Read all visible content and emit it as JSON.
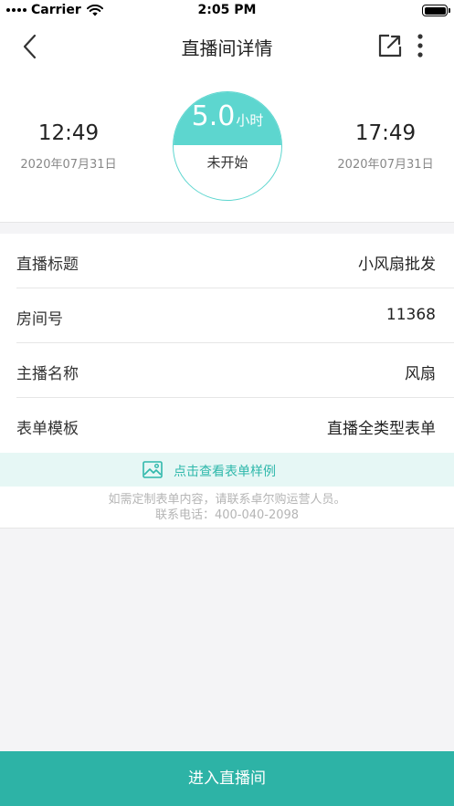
{
  "status_bar": {
    "carrier": "Carrier",
    "time": "2:05 PM"
  },
  "nav": {
    "title": "直播间详情",
    "back_icon": "chevron-left-icon",
    "share_icon": "share-icon",
    "more_icon": "more-vertical-icon"
  },
  "schedule": {
    "start_time": "12:49",
    "start_date": "2020年07月31日",
    "duration_value": "5.0",
    "duration_unit": "小时",
    "status": "未开始",
    "end_time": "17:49",
    "end_date": "2020年07月31日"
  },
  "details": {
    "title_label": "直播标题",
    "title_value": "小风扇批发",
    "room_label": "房间号",
    "room_value": "11368",
    "host_label": "主播名称",
    "host_value": "风扇",
    "form_label": "表单模板",
    "form_value": "直播全类型表单"
  },
  "sample": {
    "icon": "image-icon",
    "text": "点击查看表单样例"
  },
  "notice": {
    "line1": "如需定制表单内容，请联系卓尔购运营人员。",
    "line2": "联系电话：400-040-2098"
  },
  "footer": {
    "enter_label": "进入直播间"
  },
  "colors": {
    "accent": "#5dd6cf",
    "button": "#2db3a6",
    "link": "#2fb8ab",
    "sample_bg": "#e6f7f5"
  }
}
